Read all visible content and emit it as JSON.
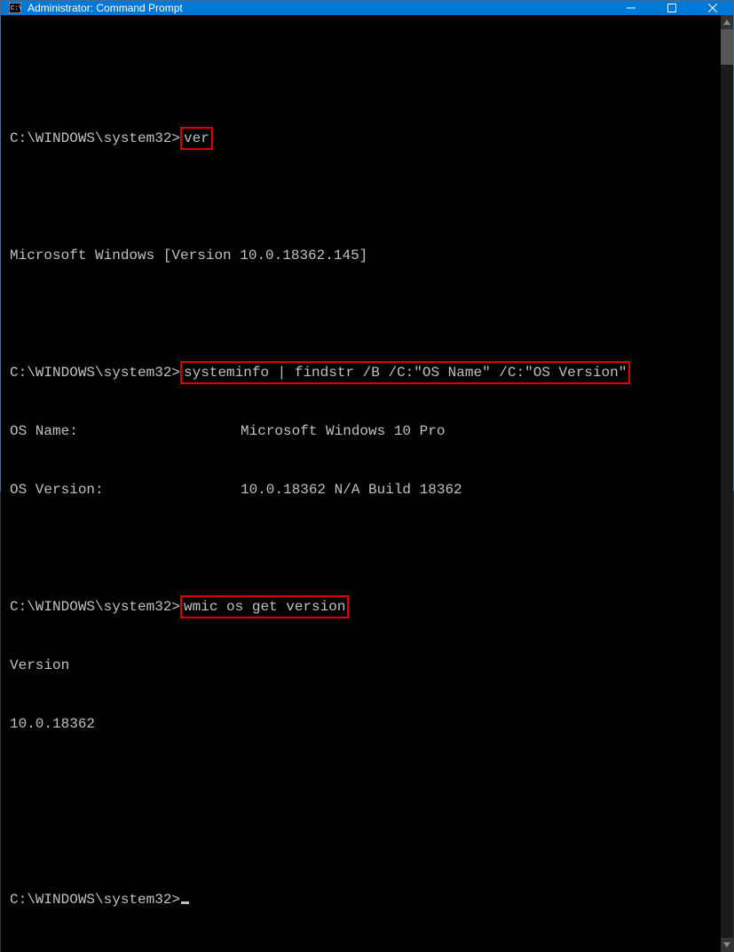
{
  "titlebar": {
    "title": "Administrator: Command Prompt"
  },
  "prompt": "C:\\WINDOWS\\system32>",
  "commands": {
    "cmd1": "ver",
    "cmd2": "systeminfo | findstr /B /C:\"OS Name\" /C:\"OS Version\"",
    "cmd3": "wmic os get version"
  },
  "output": {
    "ver_result": "Microsoft Windows [Version 10.0.18362.145]",
    "os_name_label": "OS Name:",
    "os_name_value": "Microsoft Windows 10 Pro",
    "os_version_label": "OS Version:",
    "os_version_value": "10.0.18362 N/A Build 18362",
    "wmic_header": "Version",
    "wmic_value": "10.0.18362"
  }
}
